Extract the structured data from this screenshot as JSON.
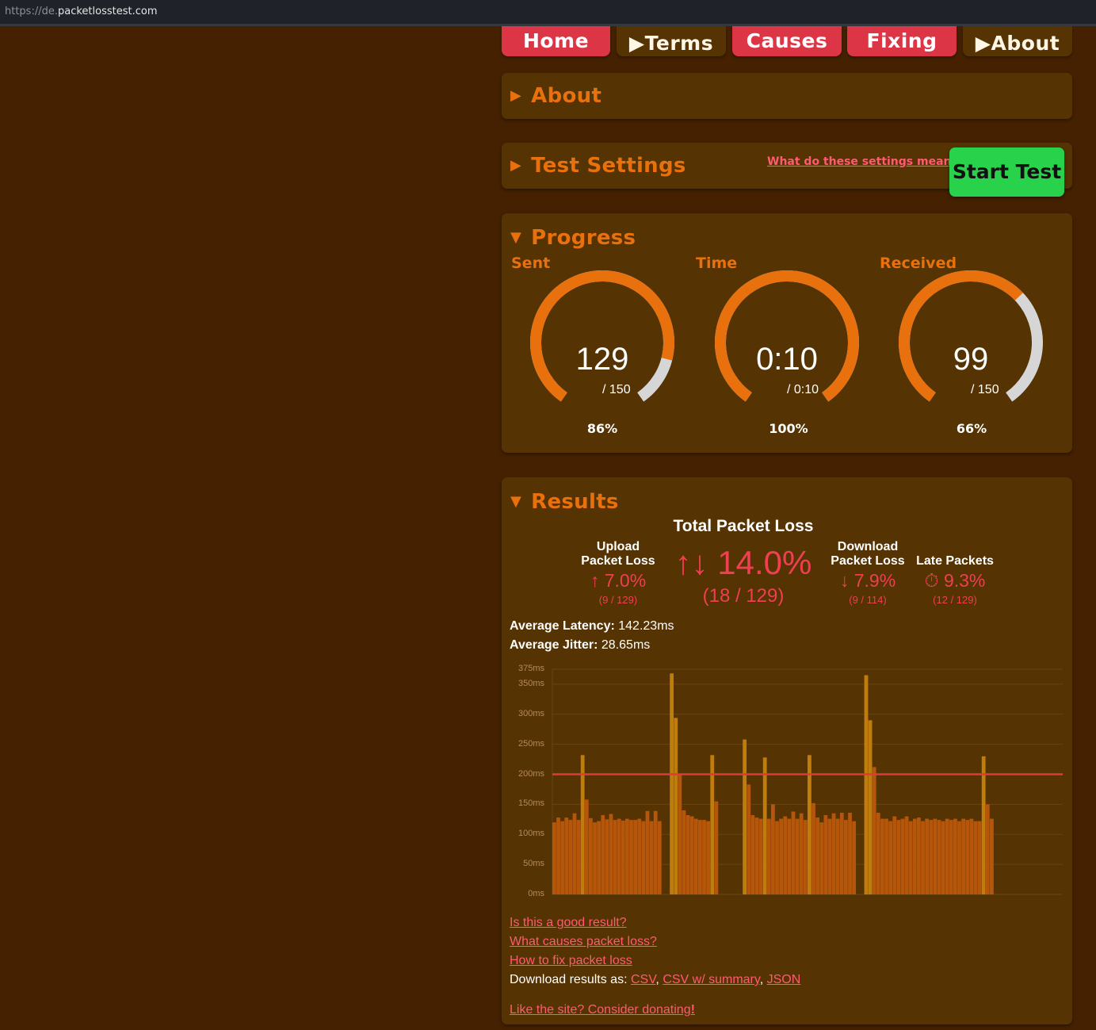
{
  "browser": {
    "url_scheme": "https://de.",
    "url_host": "packetlosstest.com"
  },
  "nav": {
    "home": "Home",
    "terms": "▶Terms",
    "causes": "Causes",
    "fixing": "Fixing",
    "about": "▶About"
  },
  "panels": {
    "about_title": "About",
    "settings_title": "Test Settings",
    "settings_link": "What do these settings mean?",
    "start_button": "Start Test",
    "progress_title": "Progress",
    "results_title": "Results"
  },
  "progress": {
    "sent": {
      "label": "Sent",
      "value": "129",
      "of": "/ 150",
      "percent": "86%",
      "fraction": 0.86
    },
    "time": {
      "label": "Time",
      "value": "0:10",
      "of": "/ 0:10",
      "percent": "100%",
      "fraction": 1.0
    },
    "received": {
      "label": "Received",
      "value": "99",
      "of": "/ 150",
      "percent": "66%",
      "fraction": 0.66
    }
  },
  "results": {
    "total_title": "Total Packet Loss",
    "total_icon": "↑↓",
    "total_value": "14.0%",
    "total_sub": "(18 / 129)",
    "upload_head1": "Upload",
    "upload_head2": "Packet Loss",
    "upload_icon": "↑",
    "upload_value": "7.0%",
    "upload_sub": "(9 / 129)",
    "download_head1": "Download",
    "download_head2": "Packet Loss",
    "download_icon": "↓",
    "download_value": "7.9%",
    "download_sub": "(9 / 114)",
    "late_head": "Late Packets",
    "late_icon": "⏱",
    "late_value": "9.3%",
    "late_sub": "(12 / 129)",
    "latency_label": "Average Latency:",
    "latency_value": "142.23ms",
    "jitter_label": "Average Jitter:",
    "jitter_value": "28.65ms"
  },
  "links": {
    "good_result": "Is this a good result?",
    "causes": "What causes packet loss?",
    "fix": "How to fix packet loss",
    "download_prefix": "Download results as:",
    "csv": "CSV",
    "csv_summary": "CSV w/ summary",
    "json": "JSON",
    "donate": "Like the site? Consider donating",
    "donate_bang": "!"
  },
  "colors": {
    "accent_orange": "#e8700d",
    "loss_red": "#f03e52",
    "bar_normal": "#b5560a",
    "bar_late": "#c07d0c",
    "threshold": "#e03a3a",
    "start_green": "#28d24a"
  },
  "chart_data": {
    "type": "bar",
    "ylabel": "",
    "ylim": [
      0,
      375
    ],
    "y_ticks": [
      "0ms",
      "50ms",
      "100ms",
      "150ms",
      "200ms",
      "250ms",
      "300ms",
      "350ms",
      "375ms"
    ],
    "threshold": 200,
    "values": [
      120,
      128,
      122,
      128,
      124,
      135,
      124,
      232,
      158,
      127,
      120,
      122,
      132,
      125,
      134,
      124,
      126,
      123,
      126,
      124,
      124,
      126,
      122,
      139,
      122,
      139,
      122,
      0,
      0,
      368,
      294,
      200,
      140,
      132,
      130,
      126,
      124,
      124,
      122,
      232,
      155,
      0,
      0,
      0,
      0,
      0,
      0,
      258,
      183,
      132,
      128,
      126,
      228,
      126,
      150,
      122,
      126,
      130,
      126,
      138,
      126,
      135,
      124,
      232,
      152,
      128,
      120,
      132,
      126,
      135,
      126,
      136,
      124,
      136,
      122,
      0,
      0,
      365,
      290,
      212,
      136,
      126,
      126,
      122,
      130,
      124,
      126,
      130,
      122,
      126,
      128,
      122,
      126,
      124,
      126,
      124,
      122,
      126,
      124,
      126,
      122,
      126,
      124,
      126,
      122,
      122,
      230,
      150,
      126
    ],
    "late_indices": [
      7,
      29,
      30,
      39,
      47,
      52,
      63,
      77,
      78,
      106
    ]
  }
}
